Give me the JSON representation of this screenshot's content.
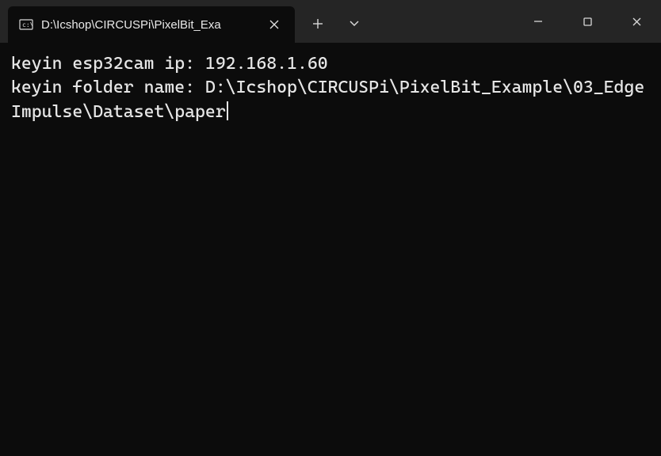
{
  "window": {
    "tab_title": "D:\\Icshop\\CIRCUSPi\\PixelBit_Exa"
  },
  "terminal": {
    "line1_prompt": "keyin esp32cam ip: ",
    "line1_value": "192.168.1.60",
    "line2_prompt": "keyin folder name: ",
    "line2_value": "D:\\Icshop\\CIRCUSPi\\PixelBit_Example\\03_EdgeImpulse\\Dataset\\paper"
  }
}
